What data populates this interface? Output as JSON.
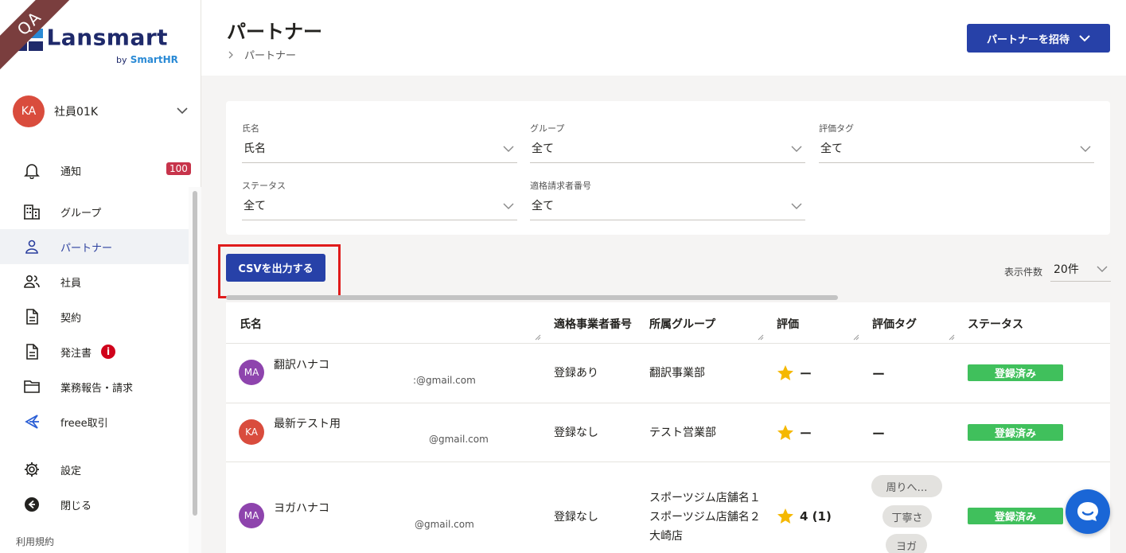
{
  "app": {
    "qa_ribbon": "QA",
    "logo_text": "Lansmart",
    "logo_by": "by",
    "logo_brand": "SmartHR"
  },
  "user": {
    "initials": "KA",
    "name": "社員01K"
  },
  "sidebar": {
    "items": [
      {
        "label": "通知",
        "icon": "bell-icon",
        "badge": "100"
      },
      {
        "label": "グループ",
        "icon": "building-icon"
      },
      {
        "label": "パートナー",
        "icon": "person-icon",
        "active": true
      },
      {
        "label": "社員",
        "icon": "people-icon"
      },
      {
        "label": "契約",
        "icon": "document-icon"
      },
      {
        "label": "発注書",
        "icon": "document-icon",
        "alert": "i"
      },
      {
        "label": "業務報告・請求",
        "icon": "folder-icon"
      },
      {
        "label": "freee取引",
        "icon": "freee-icon"
      },
      {
        "label": "設定",
        "icon": "gear-icon"
      },
      {
        "label": "閉じる",
        "icon": "arrow-left-circle-icon"
      }
    ],
    "terms": "利用規約"
  },
  "header": {
    "title": "パートナー",
    "breadcrumb": "パートナー",
    "invite_button": "パートナーを招待"
  },
  "filters": {
    "name": {
      "label": "氏名",
      "value": "氏名"
    },
    "group": {
      "label": "グループ",
      "value": "全て"
    },
    "tag": {
      "label": "評価タグ",
      "value": "全て"
    },
    "status": {
      "label": "ステータス",
      "value": "全て"
    },
    "invoice": {
      "label": "適格請求者番号",
      "value": "全て"
    }
  },
  "toolbar": {
    "csv_button": "CSVを出力する",
    "per_page_label": "表示件数",
    "per_page_value": "20件"
  },
  "table": {
    "columns": [
      "氏名",
      "適格事業者番号",
      "所属グループ",
      "評価",
      "評価タグ",
      "ステータス"
    ],
    "rows": [
      {
        "initials": "MA",
        "avatar_color": "#8e44ad",
        "name": "翻訳ハナコ",
        "email": ":@gmail.com",
        "invoice": "登録あり",
        "groups": [
          "翻訳事業部"
        ],
        "rating": "ー",
        "tags": [],
        "tag_text": "ー",
        "status": "登録済み"
      },
      {
        "initials": "KA",
        "avatar_color": "#d94c3d",
        "name": "最新テスト用",
        "email": "@gmail.com",
        "invoice": "登録なし",
        "groups": [
          "テスト営業部"
        ],
        "rating": "ー",
        "tags": [],
        "tag_text": "ー",
        "status": "登録済み"
      },
      {
        "initials": "MA",
        "avatar_color": "#8e44ad",
        "name": "ヨガハナコ",
        "email": "@gmail.com",
        "invoice": "登録なし",
        "groups": [
          "スポーツジム店舗名１",
          "スポーツジム店舗名２",
          "大崎店"
        ],
        "rating": "4 (1)",
        "tags": [
          "周りへ…",
          "丁寧さ",
          "ヨガ"
        ],
        "status": "登録済み"
      }
    ]
  },
  "colors": {
    "primary": "#2741a8",
    "status_green": "#40c05c",
    "highlight_red": "#e01b1b",
    "star": "#f5b800"
  }
}
